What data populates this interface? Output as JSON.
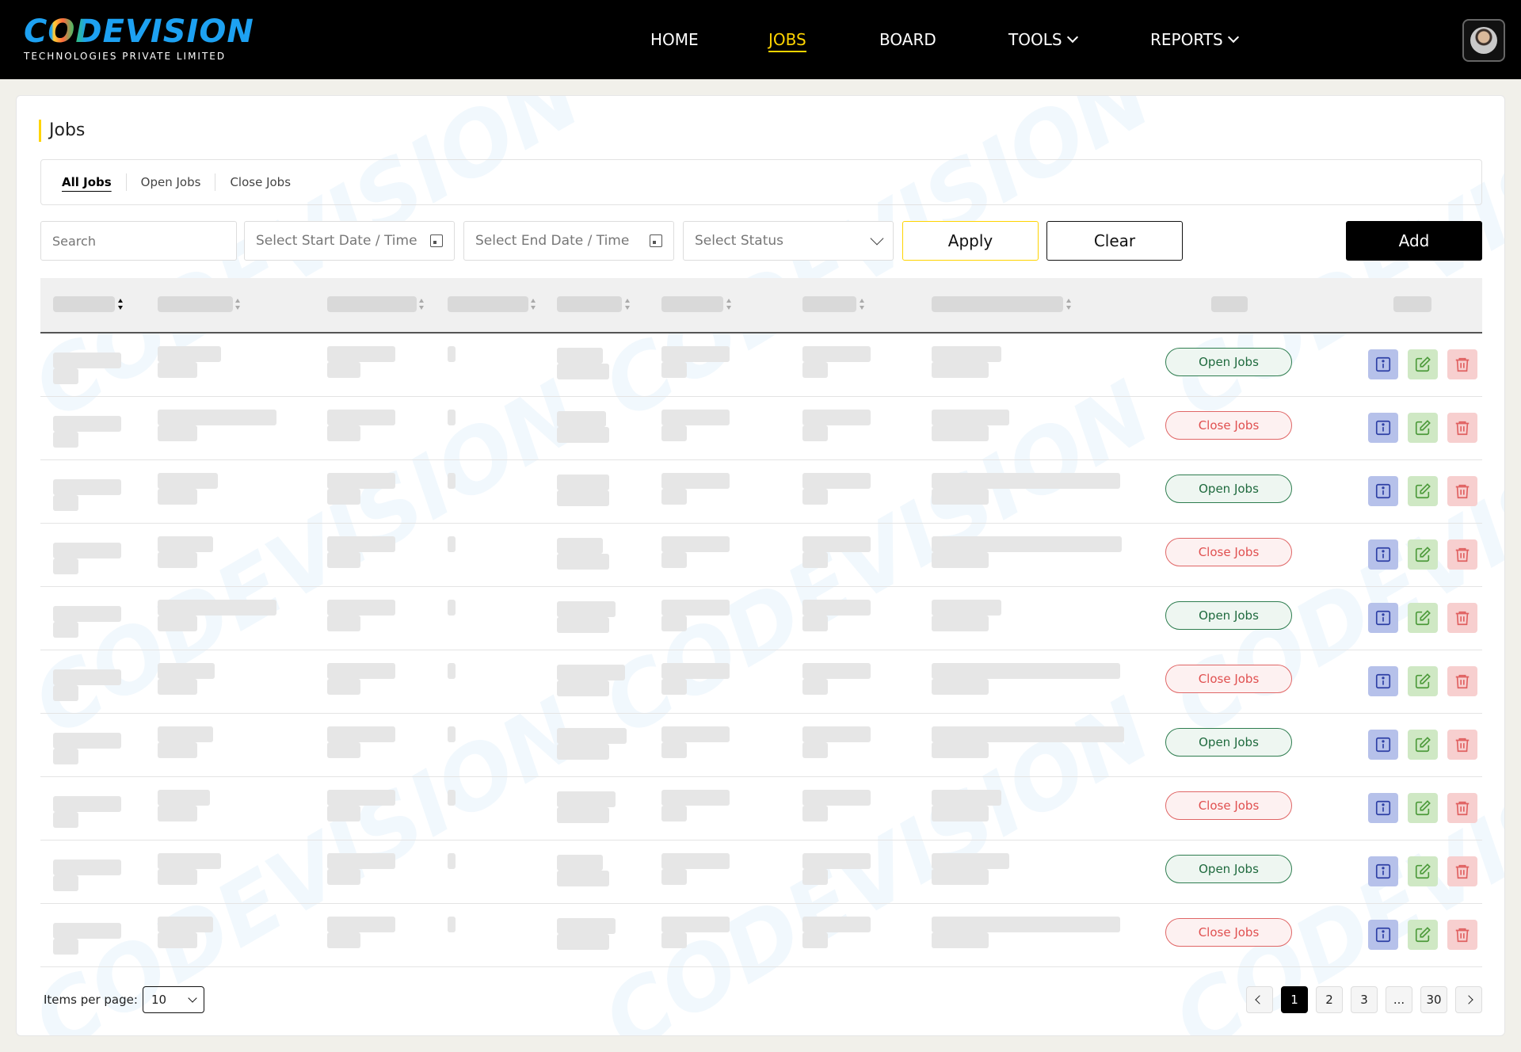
{
  "brand": {
    "name": "CODEVISION",
    "subtitle": "TECHNOLOGIES PRIVATE LIMITED"
  },
  "nav": {
    "home": "HOME",
    "jobs": "JOBS",
    "board": "BOARD",
    "tools": "TOOLS",
    "reports": "REPORTS",
    "active": "JOBS"
  },
  "page": {
    "title": "Jobs"
  },
  "tabs": {
    "all": "All Jobs",
    "open": "Open Jobs",
    "close": "Close Jobs",
    "active": "All Jobs"
  },
  "filters": {
    "search_placeholder": "Search",
    "start_date": "Select Start Date / Time",
    "end_date": "Select End Date / Time",
    "status": "Select Status",
    "apply": "Apply",
    "clear": "Clear",
    "add": "Add"
  },
  "rows": [
    {
      "status": "Open Jobs",
      "type": "open"
    },
    {
      "status": "Close Jobs",
      "type": "close"
    },
    {
      "status": "Open Jobs",
      "type": "open"
    },
    {
      "status": "Close Jobs",
      "type": "close"
    },
    {
      "status": "Open Jobs",
      "type": "open"
    },
    {
      "status": "Close Jobs",
      "type": "close"
    },
    {
      "status": "Open Jobs",
      "type": "open"
    },
    {
      "status": "Close Jobs",
      "type": "close"
    },
    {
      "status": "Open Jobs",
      "type": "open"
    },
    {
      "status": "Close Jobs",
      "type": "close"
    }
  ],
  "footer": {
    "items_per_page_label": "Items per page:",
    "items_per_page_value": "10",
    "pages": [
      "1",
      "2",
      "3",
      "...",
      "30"
    ],
    "current_page": "1"
  },
  "colors": {
    "accent": "#ffd400",
    "brand_blue": "#1da1f2",
    "open_green": "#2e7d4f",
    "close_red": "#e05050"
  }
}
